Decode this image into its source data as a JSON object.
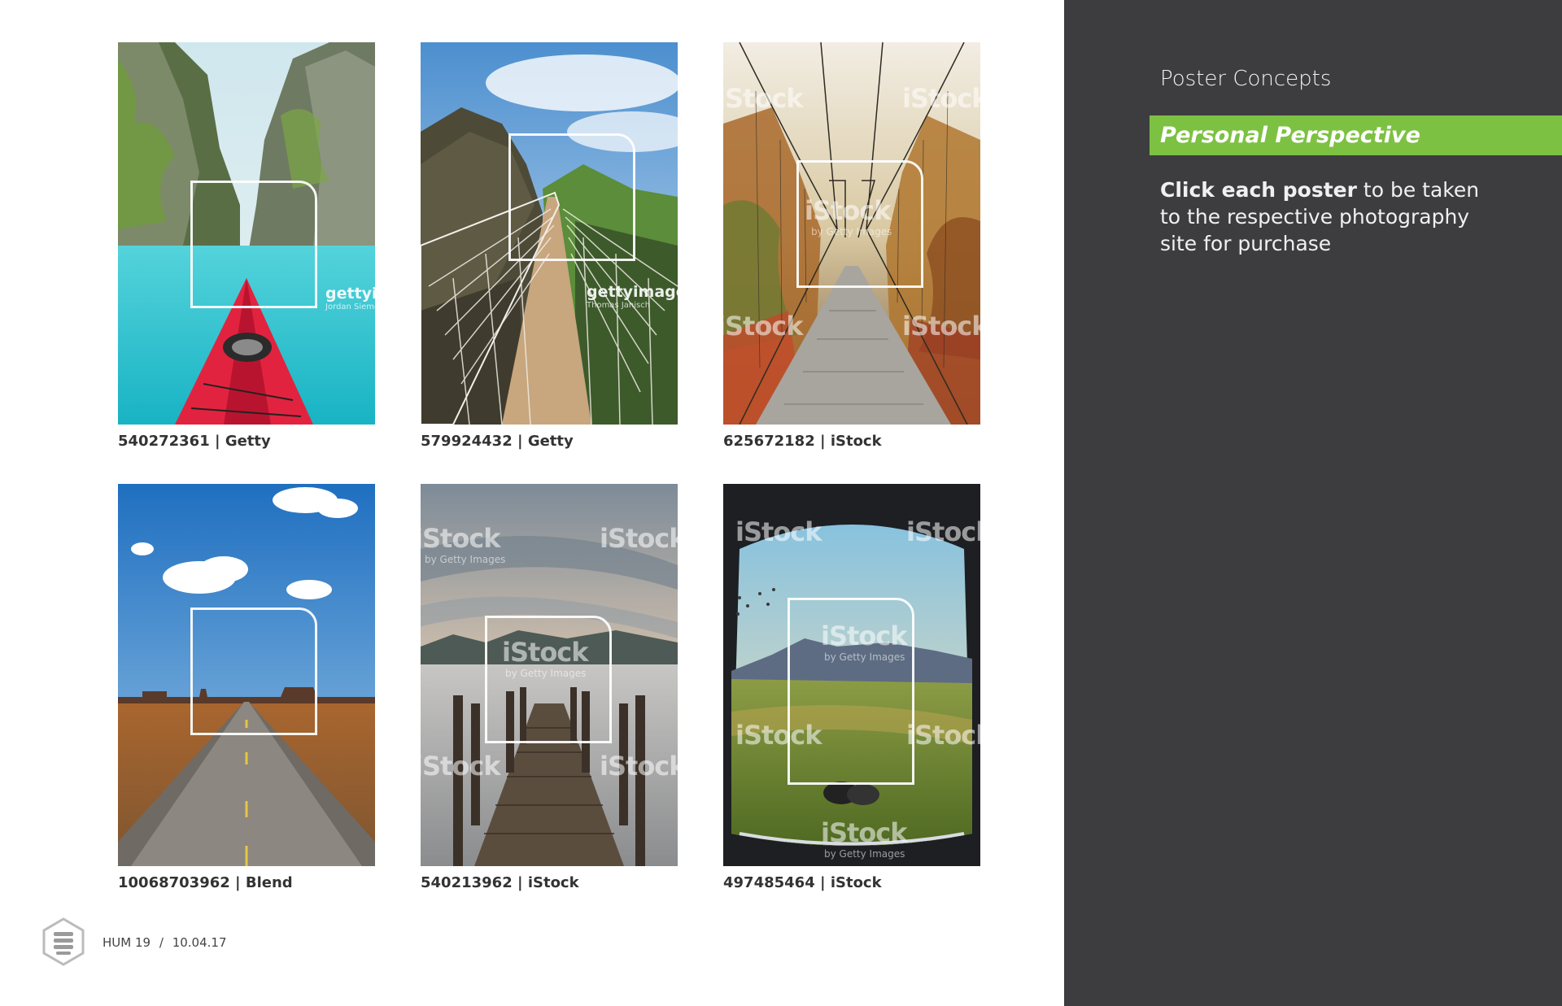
{
  "sidebar": {
    "title": "Poster Concepts",
    "section_label": "Personal Perspective",
    "instruction_bold": "Click each poster",
    "instruction_rest": "to be taken to the respective photography site for purchase",
    "accent_color": "#7dc142",
    "background_color": "#3d3d3f"
  },
  "posters": [
    {
      "id": "540272361",
      "source": "Getty",
      "caption": "540272361 | Getty",
      "scene": "kayak-lagoon",
      "watermark": "gettyimages",
      "watermark_sub": "Jordan Siemens"
    },
    {
      "id": "579924432",
      "source": "Getty",
      "caption": "579924432 | Getty",
      "scene": "rope-bridge-cliffs",
      "watermark": "gettyimages",
      "watermark_sub": "Thomas Janisch"
    },
    {
      "id": "625672182",
      "source": "iStock",
      "caption": "625672182 | iStock",
      "scene": "forest-suspension-bridge",
      "watermark": "iStock",
      "watermark_sub": "by Getty Images"
    },
    {
      "id": "10068703962",
      "source": "Blend",
      "caption": "10068703962 | Blend",
      "scene": "desert-road"
    },
    {
      "id": "540213962",
      "source": "iStock",
      "caption": "540213962 | iStock",
      "scene": "lake-jetty",
      "watermark": "iStock",
      "watermark_sub": "by Getty Images"
    },
    {
      "id": "497485464",
      "source": "iStock",
      "caption": "497485464 | iStock",
      "scene": "tent-view-mountains",
      "watermark": "iStock",
      "watermark_sub": "by Getty Images"
    }
  ],
  "footer": {
    "doc_label": "HUM 19",
    "separator": "/",
    "date": "10.04.17",
    "logo_icon": "hexagon-stack-logo-icon"
  }
}
